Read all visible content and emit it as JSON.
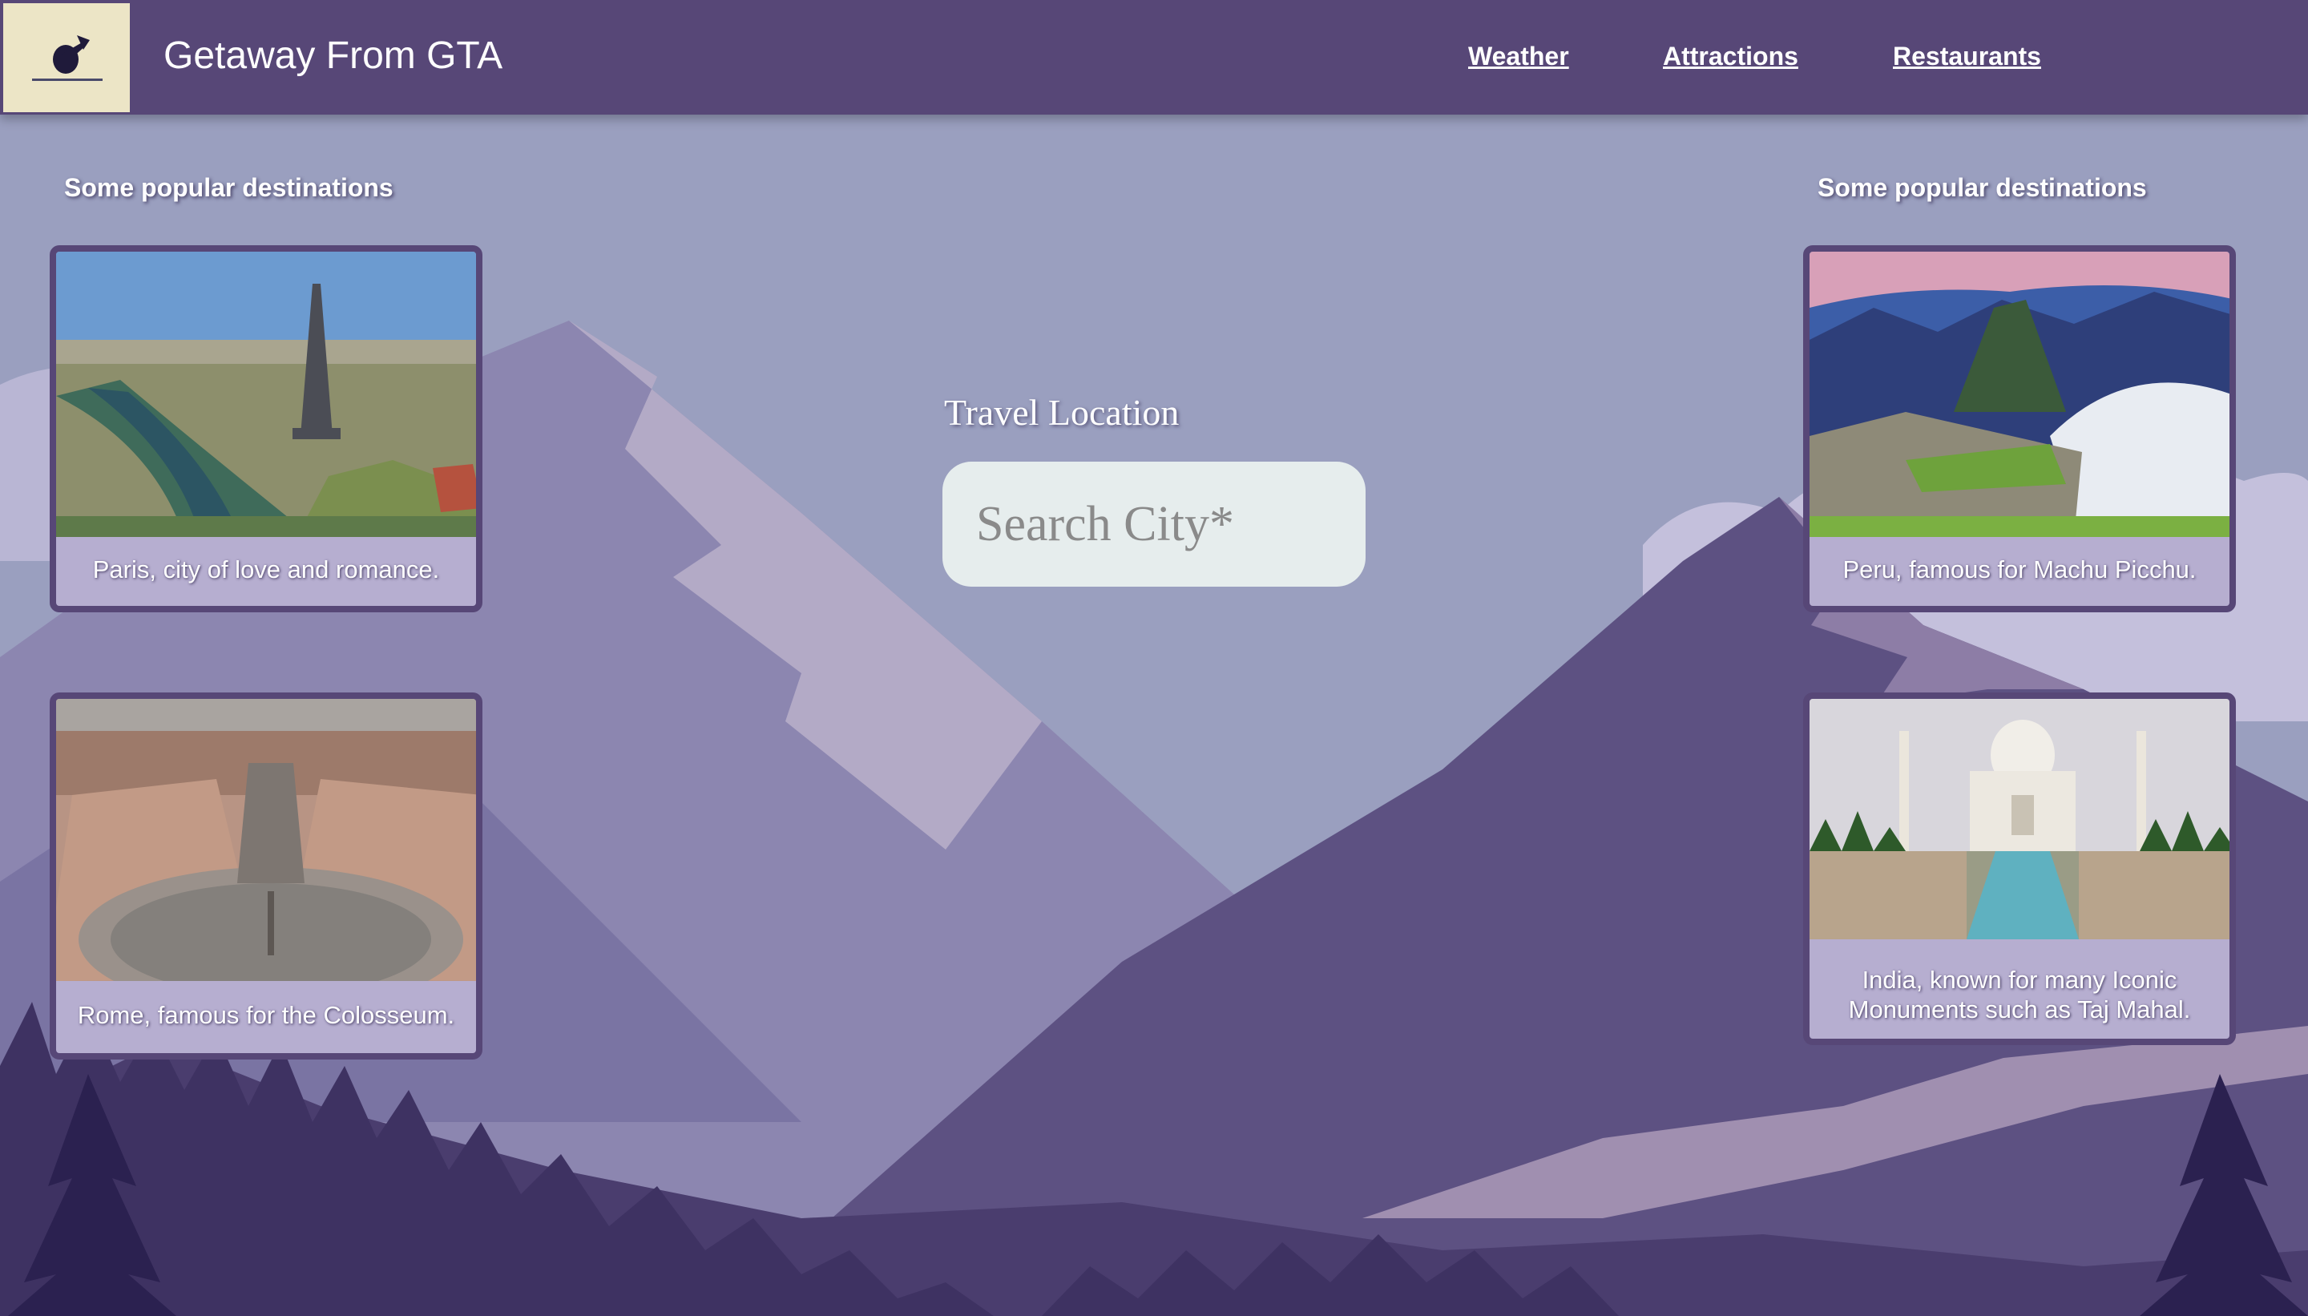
{
  "header": {
    "logo_icon": "plane-icon",
    "title": "Getaway From GTA",
    "nav": [
      {
        "label": "Weather"
      },
      {
        "label": "Attractions"
      },
      {
        "label": "Restaurants"
      }
    ]
  },
  "left": {
    "heading": "Some popular destinations",
    "cards": [
      {
        "caption": "Paris, city of love and romance.",
        "image": "eiffel-tower-photo"
      },
      {
        "caption": "Rome, famous for the Colosseum.",
        "image": "rome-aerial-photo"
      }
    ]
  },
  "right": {
    "heading": "Some popular destinations",
    "cards": [
      {
        "caption": "Peru, famous for Machu Picchu.",
        "image": "machu-picchu-photo"
      },
      {
        "caption": "India, known for many Iconic Monuments such as Taj Mahal.",
        "image": "taj-mahal-photo"
      }
    ]
  },
  "search": {
    "label": "Travel Location",
    "placeholder": "Search City*",
    "value": ""
  },
  "colors": {
    "header": "#574777",
    "card_border": "#574777",
    "search_bg": "#e6eded"
  }
}
